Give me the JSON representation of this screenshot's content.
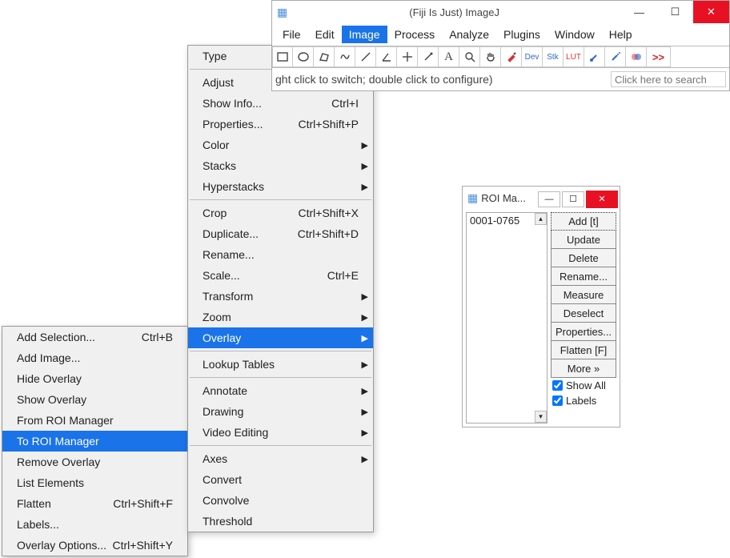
{
  "main": {
    "title": "(Fiji Is Just) ImageJ",
    "menubar": [
      "File",
      "Edit",
      "Image",
      "Process",
      "Analyze",
      "Plugins",
      "Window",
      "Help"
    ],
    "menubar_active_index": 2,
    "toolbar_icons": [
      "rect",
      "oval",
      "polygon",
      "freehand",
      "line",
      "angle",
      "point",
      "wand",
      "text",
      "magnify",
      "hand",
      "dropper",
      "dev",
      "stk",
      "lut",
      "brush",
      "spray",
      "blend",
      "more"
    ],
    "toolbar_text": {
      "dev": "Dev",
      "stk": "Stk",
      "lut": "LUT"
    },
    "status_hint": "ght click to switch; double click to configure)",
    "search_placeholder": "Click here to search"
  },
  "image_menu": [
    {
      "label": "Type",
      "arrow": true
    },
    {
      "sep": true
    },
    {
      "label": "Adjust",
      "arrow": true
    },
    {
      "label": "Show Info...",
      "shortcut": "Ctrl+I"
    },
    {
      "label": "Properties...",
      "shortcut": "Ctrl+Shift+P"
    },
    {
      "label": "Color",
      "arrow": true
    },
    {
      "label": "Stacks",
      "arrow": true
    },
    {
      "label": "Hyperstacks",
      "arrow": true
    },
    {
      "sep": true
    },
    {
      "label": "Crop",
      "shortcut": "Ctrl+Shift+X"
    },
    {
      "label": "Duplicate...",
      "shortcut": "Ctrl+Shift+D"
    },
    {
      "label": "Rename..."
    },
    {
      "label": "Scale...",
      "shortcut": "Ctrl+E"
    },
    {
      "label": "Transform",
      "arrow": true
    },
    {
      "label": "Zoom",
      "arrow": true
    },
    {
      "label": "Overlay",
      "arrow": true,
      "selected": true
    },
    {
      "sep": true
    },
    {
      "label": "Lookup Tables",
      "arrow": true
    },
    {
      "sep": true
    },
    {
      "label": "Annotate",
      "arrow": true
    },
    {
      "label": "Drawing",
      "arrow": true
    },
    {
      "label": "Video Editing",
      "arrow": true
    },
    {
      "sep": true
    },
    {
      "label": "Axes",
      "arrow": true
    },
    {
      "label": "Convert"
    },
    {
      "label": "Convolve"
    },
    {
      "label": "Threshold"
    }
  ],
  "overlay_submenu": [
    {
      "label": "Add Selection...",
      "shortcut": "Ctrl+B"
    },
    {
      "label": "Add Image..."
    },
    {
      "label": "Hide Overlay"
    },
    {
      "label": "Show Overlay"
    },
    {
      "label": "From ROI Manager"
    },
    {
      "label": "To ROI Manager",
      "selected": true
    },
    {
      "label": "Remove Overlay"
    },
    {
      "label": "List Elements"
    },
    {
      "label": "Flatten",
      "shortcut": "Ctrl+Shift+F"
    },
    {
      "label": "Labels..."
    },
    {
      "label": "Overlay Options...",
      "shortcut": "Ctrl+Shift+Y"
    }
  ],
  "roi": {
    "title": "ROI Ma...",
    "list": [
      "0001-0765"
    ],
    "buttons": [
      "Add [t]",
      "Update",
      "Delete",
      "Rename...",
      "Measure",
      "Deselect",
      "Properties...",
      "Flatten [F]",
      "More »"
    ],
    "check_show_all": "Show All",
    "check_labels": "Labels",
    "show_all_checked": true,
    "labels_checked": true
  }
}
